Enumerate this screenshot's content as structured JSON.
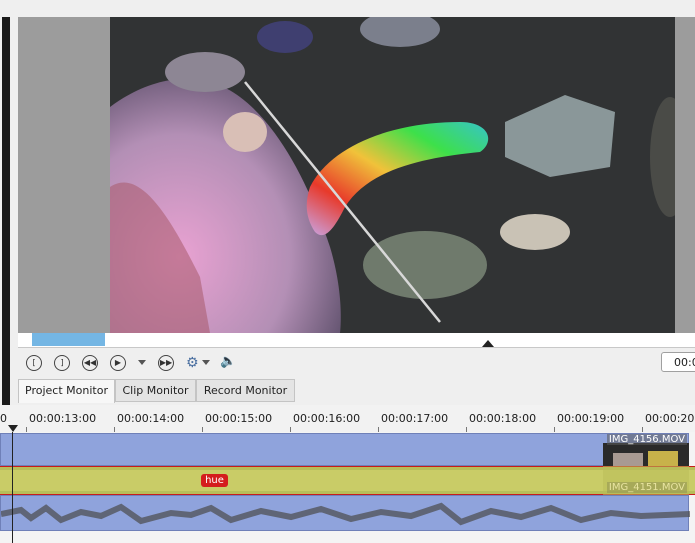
{
  "monitor": {
    "tabs": [
      {
        "label": "Project Monitor",
        "active": true
      },
      {
        "label": "Clip Monitor",
        "active": false
      },
      {
        "label": "Record Monitor",
        "active": false
      }
    ],
    "timecode": "00:0",
    "transport_icons": [
      "set-zone-in-icon",
      "set-zone-out-icon",
      "rewind-icon",
      "play-icon",
      "play-options-icon",
      "forward-icon",
      "settings-icon",
      "volume-icon"
    ]
  },
  "timeline": {
    "ruler_labels": [
      "0",
      "00:00:13:00",
      "00:00:14:00",
      "00:00:15:00",
      "00:00:16:00",
      "00:00:17:00",
      "00:00:18:00",
      "00:00:19:00",
      "00:00:20:"
    ],
    "video_clip_name": "IMG_4156.MOV",
    "audio_clip_name": "IMG_4151.MOV",
    "effect_badge": "hue"
  },
  "colors": {
    "zone": "#74b6e4",
    "video_clip": "#8fa3dc",
    "effect_track": "#b7bd5a",
    "effect_badge": "#d41d1d",
    "selection_outline": "#c81c1c"
  }
}
